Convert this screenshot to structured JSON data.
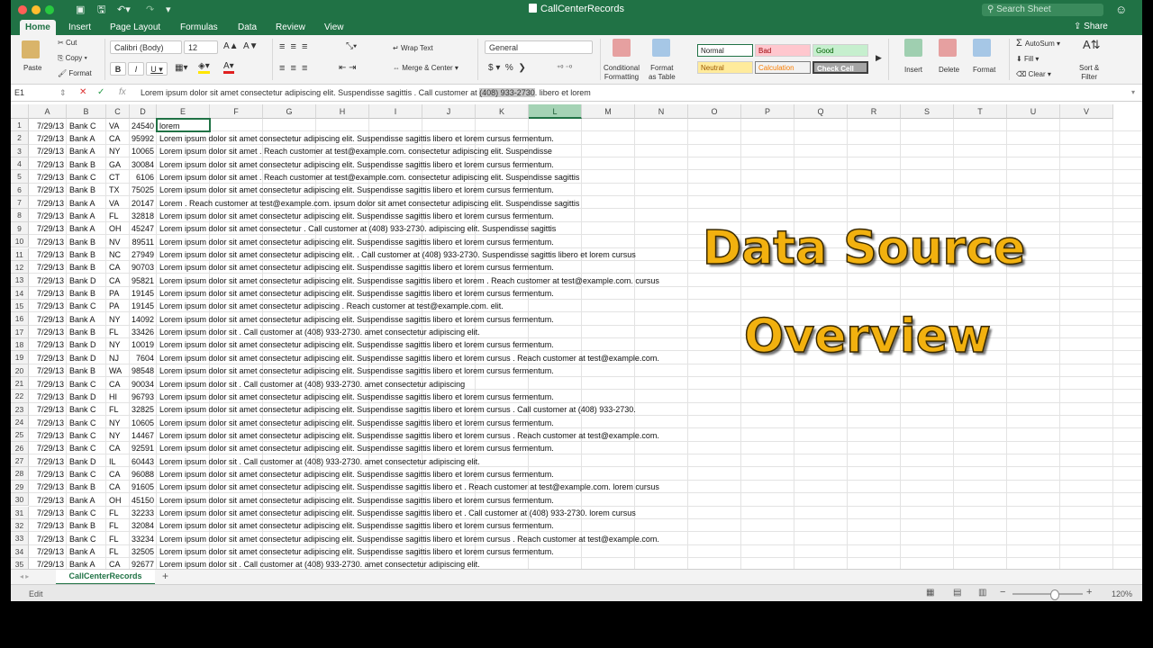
{
  "titlebar": {
    "title": "CallCenterRecords",
    "search_placeholder": "Search Sheet"
  },
  "tabs": [
    "Home",
    "Insert",
    "Page Layout",
    "Formulas",
    "Data",
    "Review",
    "View"
  ],
  "share_label": "Share",
  "ribbon": {
    "paste": "Paste",
    "cut": "Cut",
    "copy": "Copy",
    "format": "Format",
    "font_name": "Calibri (Body)",
    "font_size": "12",
    "wrap_text": "Wrap Text",
    "merge_center": "Merge & Center",
    "number_format": "General",
    "conditional_formatting": "Conditional\nFormatting",
    "format_as_table": "Format\nas Table",
    "styles": {
      "normal": "Normal",
      "bad": "Bad",
      "good": "Good",
      "neutral": "Neutral",
      "calculation": "Calculation",
      "check_cell": "Check Cell"
    },
    "insert": "Insert",
    "delete": "Delete",
    "format_cells": "Format",
    "autosum": "AutoSum",
    "fill": "Fill",
    "clear": "Clear",
    "sort_filter": "Sort &\nFilter"
  },
  "formula_bar": {
    "name_box": "E1",
    "formula_pre": "Lorem ipsum dolor sit amet consectetur adipiscing elit. Suspendisse sagittis . Call customer at ",
    "formula_highlight": "(408) 933-2730",
    "formula_post": ". libero et lorem"
  },
  "columns": [
    "A",
    "B",
    "C",
    "D",
    "E",
    "F",
    "G",
    "H",
    "I",
    "J",
    "K",
    "L",
    "M",
    "N",
    "O",
    "P",
    "Q",
    "R",
    "S",
    "T",
    "U",
    "V"
  ],
  "rows": [
    [
      "7/29/13",
      "Bank C",
      "VA",
      "24540",
      "lorem"
    ],
    [
      "7/29/13",
      "Bank A",
      "CA",
      "95992",
      "Lorem ipsum dolor sit amet consectetur adipiscing elit. Suspendisse sagittis libero et lorem cursus fermentum."
    ],
    [
      "7/29/13",
      "Bank A",
      "NY",
      "10065",
      "Lorem ipsum dolor sit amet . Reach customer at test@example.com. consectetur adipiscing elit. Suspendisse"
    ],
    [
      "7/29/13",
      "Bank B",
      "GA",
      "30084",
      "Lorem ipsum dolor sit amet consectetur adipiscing elit. Suspendisse sagittis libero et lorem cursus fermentum."
    ],
    [
      "7/29/13",
      "Bank C",
      "CT",
      "6106",
      "Lorem ipsum dolor sit amet . Reach customer at test@example.com. consectetur adipiscing elit. Suspendisse sagittis"
    ],
    [
      "7/29/13",
      "Bank B",
      "TX",
      "75025",
      "Lorem ipsum dolor sit amet consectetur adipiscing elit. Suspendisse sagittis libero et lorem cursus fermentum."
    ],
    [
      "7/29/13",
      "Bank A",
      "VA",
      "20147",
      "Lorem . Reach customer at test@example.com. ipsum dolor sit amet consectetur adipiscing elit. Suspendisse sagittis"
    ],
    [
      "7/29/13",
      "Bank A",
      "FL",
      "32818",
      "Lorem ipsum dolor sit amet consectetur adipiscing elit. Suspendisse sagittis libero et lorem cursus fermentum."
    ],
    [
      "7/29/13",
      "Bank A",
      "OH",
      "45247",
      "Lorem ipsum dolor sit amet consectetur . Call customer at (408) 933-2730. adipiscing elit. Suspendisse sagittis"
    ],
    [
      "7/29/13",
      "Bank B",
      "NV",
      "89511",
      "Lorem ipsum dolor sit amet consectetur adipiscing elit. Suspendisse sagittis libero et lorem cursus fermentum."
    ],
    [
      "7/29/13",
      "Bank B",
      "NC",
      "27949",
      "Lorem ipsum dolor sit amet consectetur adipiscing elit. . Call customer at (408) 933-2730. Suspendisse sagittis libero et lorem cursus"
    ],
    [
      "7/29/13",
      "Bank B",
      "CA",
      "90703",
      "Lorem ipsum dolor sit amet consectetur adipiscing elit. Suspendisse sagittis libero et lorem cursus fermentum."
    ],
    [
      "7/29/13",
      "Bank D",
      "CA",
      "95821",
      "Lorem ipsum dolor sit amet consectetur adipiscing elit. Suspendisse sagittis libero et lorem . Reach customer at test@example.com. cursus"
    ],
    [
      "7/29/13",
      "Bank B",
      "PA",
      "19145",
      "Lorem ipsum dolor sit amet consectetur adipiscing elit. Suspendisse sagittis libero et lorem cursus fermentum."
    ],
    [
      "7/29/13",
      "Bank C",
      "PA",
      "19145",
      "Lorem ipsum dolor sit amet consectetur adipiscing . Reach customer at test@example.com. elit."
    ],
    [
      "7/29/13",
      "Bank A",
      "NY",
      "14092",
      "Lorem ipsum dolor sit amet consectetur adipiscing elit. Suspendisse sagittis libero et lorem cursus fermentum."
    ],
    [
      "7/29/13",
      "Bank B",
      "FL",
      "33426",
      "Lorem ipsum dolor sit . Call customer at (408) 933-2730. amet consectetur adipiscing elit."
    ],
    [
      "7/29/13",
      "Bank D",
      "NY",
      "10019",
      "Lorem ipsum dolor sit amet consectetur adipiscing elit. Suspendisse sagittis libero et lorem cursus fermentum."
    ],
    [
      "7/29/13",
      "Bank D",
      "NJ",
      "7604",
      "Lorem ipsum dolor sit amet consectetur adipiscing elit. Suspendisse sagittis libero et lorem cursus . Reach customer at test@example.com."
    ],
    [
      "7/29/13",
      "Bank B",
      "WA",
      "98548",
      "Lorem ipsum dolor sit amet consectetur adipiscing elit. Suspendisse sagittis libero et lorem cursus fermentum."
    ],
    [
      "7/29/13",
      "Bank C",
      "CA",
      "90034",
      "Lorem ipsum dolor sit . Call customer at (408) 933-2730. amet consectetur adipiscing"
    ],
    [
      "7/29/13",
      "Bank D",
      "HI",
      "96793",
      "Lorem ipsum dolor sit amet consectetur adipiscing elit. Suspendisse sagittis libero et lorem cursus fermentum."
    ],
    [
      "7/29/13",
      "Bank C",
      "FL",
      "32825",
      "Lorem ipsum dolor sit amet consectetur adipiscing elit. Suspendisse sagittis libero et lorem cursus . Call customer at (408) 933-2730."
    ],
    [
      "7/29/13",
      "Bank C",
      "NY",
      "10605",
      "Lorem ipsum dolor sit amet consectetur adipiscing elit. Suspendisse sagittis libero et lorem cursus fermentum."
    ],
    [
      "7/29/13",
      "Bank C",
      "NY",
      "14467",
      "Lorem ipsum dolor sit amet consectetur adipiscing elit. Suspendisse sagittis libero et lorem cursus . Reach customer at test@example.com."
    ],
    [
      "7/29/13",
      "Bank C",
      "CA",
      "92591",
      "Lorem ipsum dolor sit amet consectetur adipiscing elit. Suspendisse sagittis libero et lorem cursus fermentum."
    ],
    [
      "7/29/13",
      "Bank D",
      "IL",
      "60443",
      "Lorem ipsum dolor sit . Call customer at (408) 933-2730. amet consectetur adipiscing elit."
    ],
    [
      "7/29/13",
      "Bank C",
      "CA",
      "96088",
      "Lorem ipsum dolor sit amet consectetur adipiscing elit. Suspendisse sagittis libero et lorem cursus fermentum."
    ],
    [
      "7/29/13",
      "Bank B",
      "CA",
      "91605",
      "Lorem ipsum dolor sit amet consectetur adipiscing elit. Suspendisse sagittis libero et . Reach customer at test@example.com. lorem cursus"
    ],
    [
      "7/29/13",
      "Bank A",
      "OH",
      "45150",
      "Lorem ipsum dolor sit amet consectetur adipiscing elit. Suspendisse sagittis libero et lorem cursus fermentum."
    ],
    [
      "7/29/13",
      "Bank C",
      "FL",
      "32233",
      "Lorem ipsum dolor sit amet consectetur adipiscing elit. Suspendisse sagittis libero et . Call customer at (408) 933-2730. lorem cursus"
    ],
    [
      "7/29/13",
      "Bank B",
      "FL",
      "32084",
      "Lorem ipsum dolor sit amet consectetur adipiscing elit. Suspendisse sagittis libero et lorem cursus fermentum."
    ],
    [
      "7/29/13",
      "Bank C",
      "FL",
      "33234",
      "Lorem ipsum dolor sit amet consectetur adipiscing elit. Suspendisse sagittis libero et lorem cursus . Reach customer at test@example.com."
    ],
    [
      "7/29/13",
      "Bank A",
      "FL",
      "32505",
      "Lorem ipsum dolor sit amet consectetur adipiscing elit. Suspendisse sagittis libero et lorem cursus fermentum."
    ],
    [
      "7/29/13",
      "Bank A",
      "CA",
      "92677",
      "Lorem ipsum dolor sit . Call customer at (408) 933-2730. amet consectetur adipiscing elit."
    ]
  ],
  "overlay": {
    "line1": "Data Source",
    "line2": "Overview"
  },
  "sheet_tab": "CallCenterRecords",
  "status": {
    "mode": "Edit",
    "zoom": "120%"
  },
  "colors": {
    "accent": "#207245",
    "overlay_text": "#f2b10f"
  }
}
